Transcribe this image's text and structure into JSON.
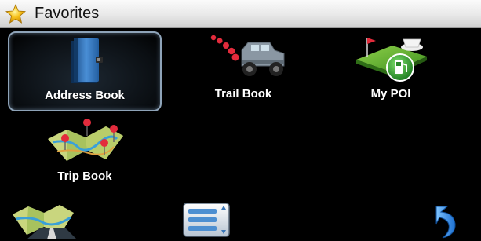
{
  "header": {
    "title": "Favorites",
    "icon": "star-icon"
  },
  "tiles": [
    {
      "label": "Address Book",
      "icon": "address-book-icon",
      "selected": true
    },
    {
      "label": "Trail Book",
      "icon": "jeep-trail-icon",
      "selected": false
    },
    {
      "label": "My POI",
      "icon": "poi-gas-station-icon",
      "selected": false
    },
    {
      "label": "Trip Book",
      "icon": "trip-map-icon",
      "selected": false
    }
  ],
  "toolbar": {
    "map_button": "map-icon",
    "list_button": "list-icon",
    "back_button": "back-arrow-icon"
  },
  "colors": {
    "background": "#000000",
    "selection_border": "#8ea3b8",
    "label": "#ffffff"
  }
}
